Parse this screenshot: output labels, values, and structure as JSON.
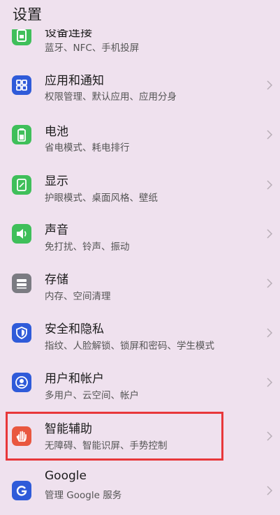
{
  "header": {
    "title": "设置"
  },
  "items": [
    {
      "title": "设备连接",
      "subtitle": "蓝牙、NFC、手机投屏",
      "icon": "device-connection-icon"
    },
    {
      "title": "应用和通知",
      "subtitle": "权限管理、默认应用、应用分身",
      "icon": "apps-icon"
    },
    {
      "title": "电池",
      "subtitle": "省电模式、耗电排行",
      "icon": "battery-icon"
    },
    {
      "title": "显示",
      "subtitle": "护眼模式、桌面风格、壁纸",
      "icon": "display-icon"
    },
    {
      "title": "声音",
      "subtitle": "免打扰、铃声、振动",
      "icon": "sound-icon"
    },
    {
      "title": "存储",
      "subtitle": "内存、空间清理",
      "icon": "storage-icon"
    },
    {
      "title": "安全和隐私",
      "subtitle": "指纹、人脸解锁、锁屏和密码、学生模式",
      "icon": "shield-icon"
    },
    {
      "title": "用户和帐户",
      "subtitle": "多用户、云空间、帐户",
      "icon": "user-icon"
    },
    {
      "title": "智能辅助",
      "subtitle": "无障碍、智能识屏、手势控制",
      "icon": "hand-icon"
    },
    {
      "title": "Google",
      "subtitle": "管理 Google 服务",
      "icon": "google-icon"
    }
  ],
  "colors": {
    "background": "#efe1ee",
    "highlight_border": "#e8373a",
    "green": "#3fbf5a",
    "blue": "#2f5bd9",
    "gray": "#7b7b82",
    "orange_red": "#e9573f"
  }
}
